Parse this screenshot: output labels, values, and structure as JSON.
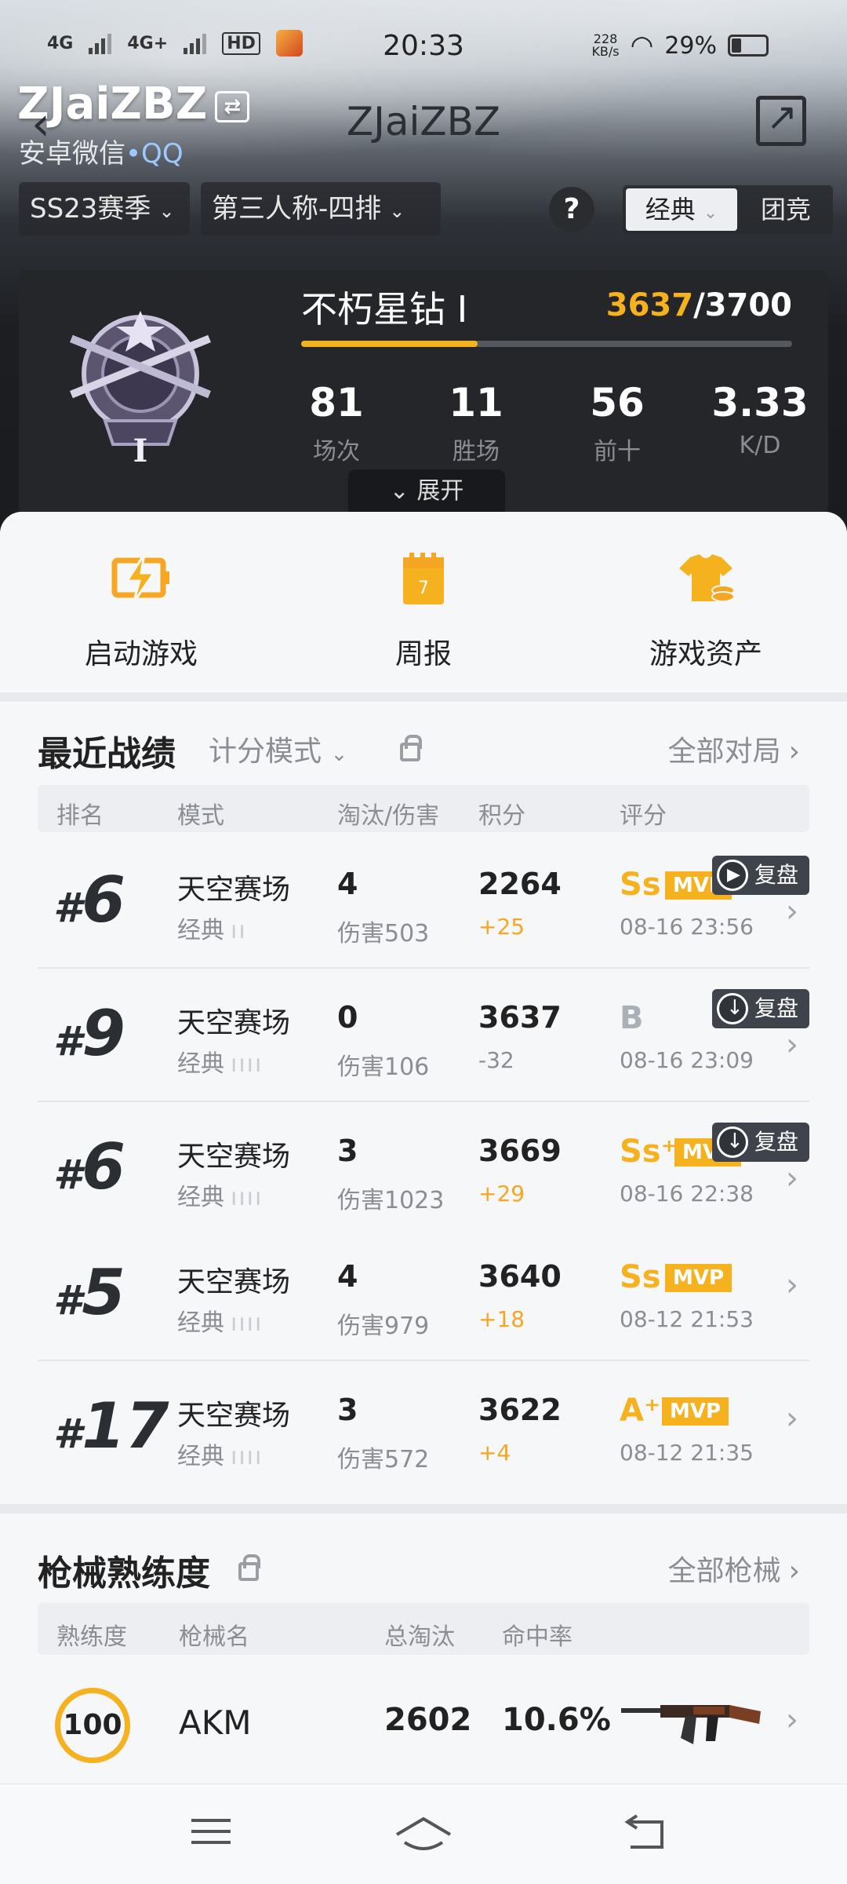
{
  "status": {
    "net1": "4G",
    "net2": "4G+",
    "hd": "HD",
    "time": "20:33",
    "speed": "228",
    "speed_unit": "KB/s",
    "battery": "29%"
  },
  "header": {
    "owner_name": "ZJaiZBZ",
    "owner_sub": "安卓微信",
    "owner_sub_link": "•QQ",
    "title": "ZJaiZBZ"
  },
  "filters": {
    "season": "SS23赛季",
    "mode": "第三人称-四排",
    "help": "?",
    "seg_on": "经典",
    "seg_off": "团竞"
  },
  "rank": {
    "tier": "不朽星钻 Ⅰ",
    "points_cur": "3637",
    "points_sep": "/",
    "points_max": "3700",
    "progress": 0.36,
    "stats": [
      {
        "value": "81",
        "label": "场次"
      },
      {
        "value": "11",
        "label": "胜场"
      },
      {
        "value": "56",
        "label": "前十"
      },
      {
        "value": "3.33",
        "label": "K/D"
      }
    ],
    "expand": "展开"
  },
  "quick": [
    {
      "label": "启动游戏",
      "icon": "lightning-icon"
    },
    {
      "label": "周报",
      "icon": "calendar-icon",
      "badge": "7"
    },
    {
      "label": "游戏资产",
      "icon": "shirt-coins-icon"
    }
  ],
  "recent": {
    "title": "最近战绩",
    "mode": "计分模式",
    "link": "全部对局",
    "headers": [
      "排名",
      "模式",
      "淘汰/伤害",
      "积分",
      "评分"
    ],
    "matches": [
      {
        "rank_prefix": "#",
        "rank": "6",
        "map": "天空赛场",
        "mode": "经典",
        "team": "ıı",
        "kills": "4",
        "damage": "伤害503",
        "score": "2264",
        "delta": "+25",
        "grade": "Ss",
        "mvp": "MVP",
        "date": "08-16 23:56",
        "replay": "复盘"
      },
      {
        "rank_prefix": "#",
        "rank": "9",
        "map": "天空赛场",
        "mode": "经典",
        "team": "ıııı",
        "kills": "0",
        "damage": "伤害106",
        "score": "3637",
        "delta": "-32",
        "grade": "B",
        "mvp": "",
        "date": "08-16 23:09",
        "replay": "复盘"
      },
      {
        "rank_prefix": "#",
        "rank": "6",
        "map": "天空赛场",
        "mode": "经典",
        "team": "ıııı",
        "kills": "3",
        "damage": "伤害1023",
        "score": "3669",
        "delta": "+29",
        "grade": "Ss⁺",
        "mvp": "MVP",
        "date": "08-16 22:38",
        "replay": "复盘"
      },
      {
        "rank_prefix": "#",
        "rank": "5",
        "map": "天空赛场",
        "mode": "经典",
        "team": "ıııı",
        "kills": "4",
        "damage": "伤害979",
        "score": "3640",
        "delta": "+18",
        "grade": "Ss",
        "mvp": "MVP",
        "date": "08-12 21:53",
        "replay": ""
      },
      {
        "rank_prefix": "#",
        "rank": "17",
        "map": "天空赛场",
        "mode": "经典",
        "team": "ıııı",
        "kills": "3",
        "damage": "伤害572",
        "score": "3622",
        "delta": "+4",
        "grade": "A⁺",
        "mvp": "MVP",
        "date": "08-12 21:35",
        "replay": ""
      }
    ]
  },
  "weapons": {
    "title": "枪械熟练度",
    "link": "全部枪械",
    "headers": [
      "熟练度",
      "枪械名",
      "总淘汰",
      "命中率"
    ],
    "items": [
      {
        "level": "100",
        "name": "AKM",
        "kills": "2602",
        "accuracy": "10.6%"
      }
    ]
  },
  "colors": {
    "accent": "#f5b21e",
    "dark_card": "#24262a",
    "page_bg": "#f2f4f7"
  }
}
